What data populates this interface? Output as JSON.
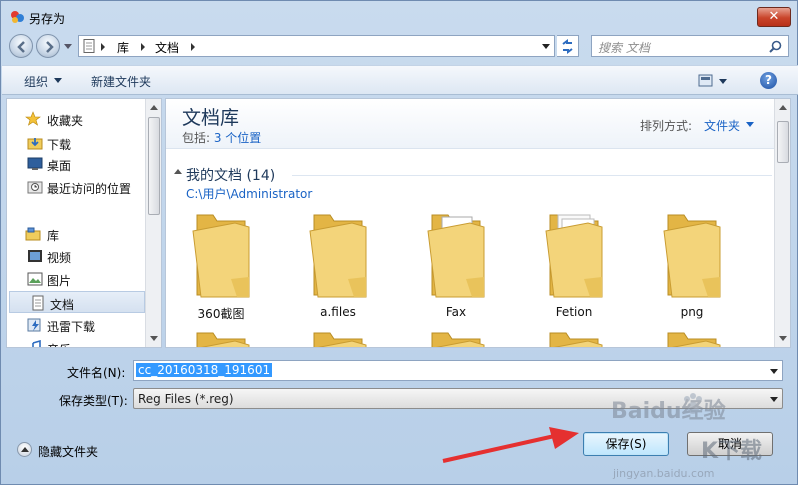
{
  "window": {
    "title": "另存为",
    "close_label": "✕"
  },
  "address": {
    "crumbs": [
      "库",
      "文档"
    ]
  },
  "search": {
    "placeholder": "搜索 文档"
  },
  "toolbar": {
    "organize": "组织",
    "new_folder": "新建文件夹",
    "help": "?"
  },
  "navpane": {
    "items": [
      {
        "label": "收藏夹",
        "icon": "star-icon",
        "kind": "top"
      },
      {
        "label": "下载",
        "icon": "download-folder-icon",
        "kind": "item"
      },
      {
        "label": "桌面",
        "icon": "desktop-icon",
        "kind": "item"
      },
      {
        "label": "最近访问的位置",
        "icon": "recent-places-icon",
        "kind": "item"
      },
      {
        "label": "库",
        "icon": "library-icon",
        "kind": "top"
      },
      {
        "label": "视频",
        "icon": "video-icon",
        "kind": "item"
      },
      {
        "label": "图片",
        "icon": "picture-icon",
        "kind": "item"
      },
      {
        "label": "文档",
        "icon": "document-icon",
        "kind": "item",
        "selected": true
      },
      {
        "label": "迅雷下载",
        "icon": "thunder-download-icon",
        "kind": "item"
      },
      {
        "label": "音乐",
        "icon": "music-icon",
        "kind": "item"
      }
    ]
  },
  "content": {
    "library_title": "文档库",
    "includes_prefix": "包括: ",
    "includes_link": "3 个位置",
    "arrange_label": "排列方式:",
    "arrange_value": "文件夹",
    "group_title": "我的文档 (14)",
    "group_path": "C:\\用户\\Administrator",
    "folders": [
      "360截图",
      "a.files",
      "Fax",
      "Fetion",
      "png"
    ]
  },
  "form": {
    "filename_label": "文件名(N):",
    "filename_value": "cc_20160318_191601",
    "filetype_label": "保存类型(T):",
    "filetype_value": "Reg Files (*.reg)",
    "hide_folders": "隐藏文件夹",
    "save": "保存(S)",
    "cancel": "取消"
  },
  "watermark": {
    "text_main": "Baidu经验",
    "text_sub": "jingyan.baidu.com",
    "site": "K下载"
  },
  "colors": {
    "accent": "#1a63c5",
    "title_blue": "#1e395b",
    "selection": "#3399ff",
    "arrow_red": "#e53030"
  }
}
